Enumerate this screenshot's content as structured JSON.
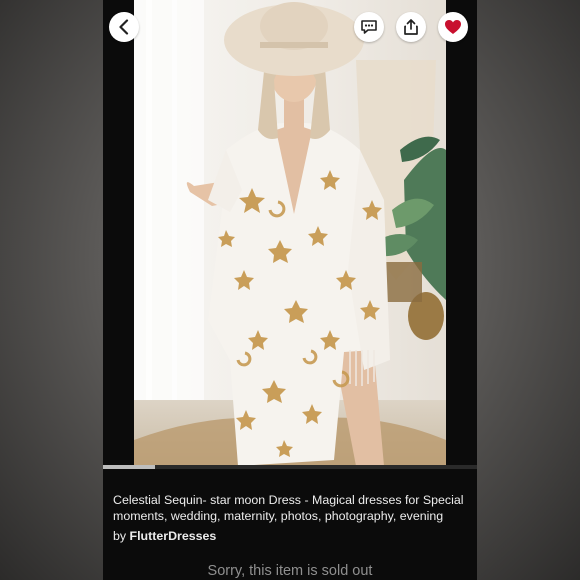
{
  "listing": {
    "title": "Celestial Sequin- star moon Dress - Magical dresses for Special moments, wedding, maternity, photos, photography, evening",
    "seller_prefix": "by",
    "seller_name": "FlutterDresses",
    "sold_out_message": "Sorry, this item is sold out",
    "is_favorited": true
  },
  "gallery": {
    "progress": 0.14,
    "photo_description_colors": {
      "dress": "#f6f3ee",
      "sequin": "#c79a52",
      "hat": "#e8dccb"
    }
  },
  "toolbar": {
    "back_icon": "chevron-left-icon",
    "message_icon": "chat-dots-icon",
    "share_icon": "share-upload-icon",
    "favorite_icon": "heart-icon"
  },
  "colors": {
    "favorite": "#c8102e",
    "text": "#ececec",
    "muted": "#8f8f8f",
    "background": "#0b0b0b"
  }
}
